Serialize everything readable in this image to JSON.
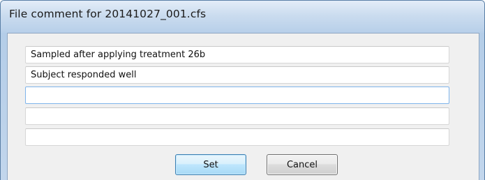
{
  "dialog": {
    "title": "File comment for 20141027_001.cfs"
  },
  "comments": [
    {
      "value": "Sampled after applying treatment 26b"
    },
    {
      "value": "Subject responded well"
    },
    {
      "value": ""
    },
    {
      "value": ""
    },
    {
      "value": ""
    }
  ],
  "buttons": {
    "set_label": "Set",
    "cancel_label": "Cancel"
  }
}
